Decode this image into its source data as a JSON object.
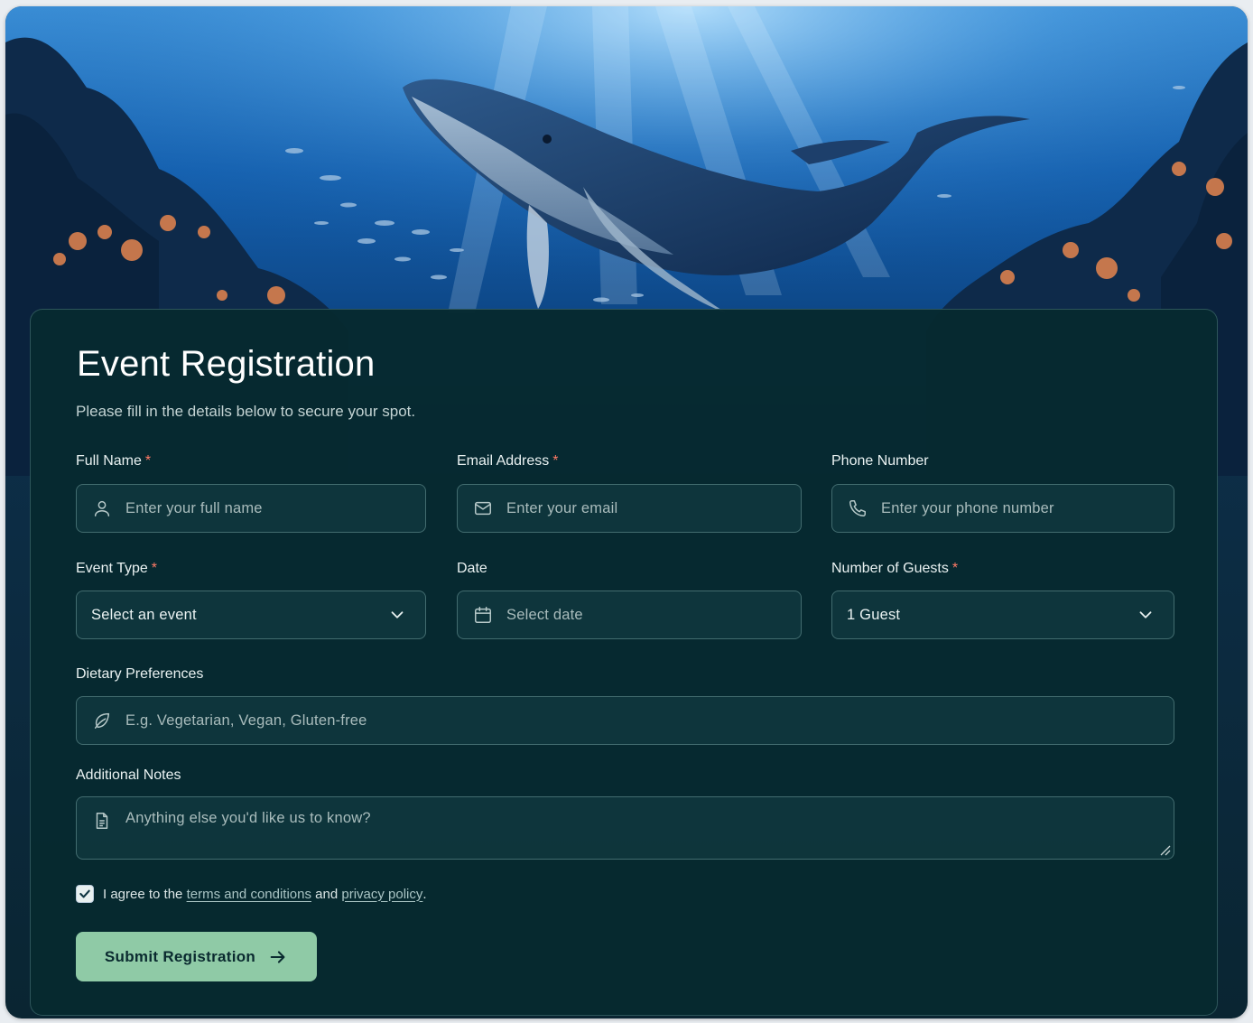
{
  "form": {
    "title": "Event Registration",
    "subtitle": "Please fill in the details below to secure your spot.",
    "full_name": {
      "label": "Full Name",
      "required_mark": "*",
      "placeholder": "Enter your full name",
      "icon": "user-icon"
    },
    "email": {
      "label": "Email Address",
      "required_mark": "*",
      "placeholder": "Enter your email",
      "icon": "mail-icon"
    },
    "phone": {
      "label": "Phone Number",
      "placeholder": "Enter your phone number",
      "icon": "phone-icon"
    },
    "event_type": {
      "label": "Event Type",
      "required_mark": "*",
      "selected": "Select an event",
      "icon": "chevron-down-icon"
    },
    "date": {
      "label": "Date",
      "placeholder": "Select date",
      "icon": "calendar-icon"
    },
    "guests": {
      "label": "Number of Guests",
      "required_mark": "*",
      "selected": "1 Guest",
      "icon": "chevron-down-icon"
    },
    "dietary": {
      "label": "Dietary Preferences",
      "placeholder": "E.g. Vegetarian, Vegan, Gluten-free",
      "icon": "leaf-icon"
    },
    "notes": {
      "label": "Additional Notes",
      "placeholder": "Anything else you'd like us to know?",
      "icon": "document-icon"
    },
    "agreement": {
      "prefix": "I agree to the",
      "terms_link": "terms and conditions",
      "middle": "and",
      "privacy_link": "privacy policy",
      "suffix": ".",
      "checked": true
    },
    "submit_label": "Submit Registration"
  },
  "colors": {
    "accent": "#8fcaa6",
    "card_bg": "#062930",
    "required": "#ff7a66"
  }
}
